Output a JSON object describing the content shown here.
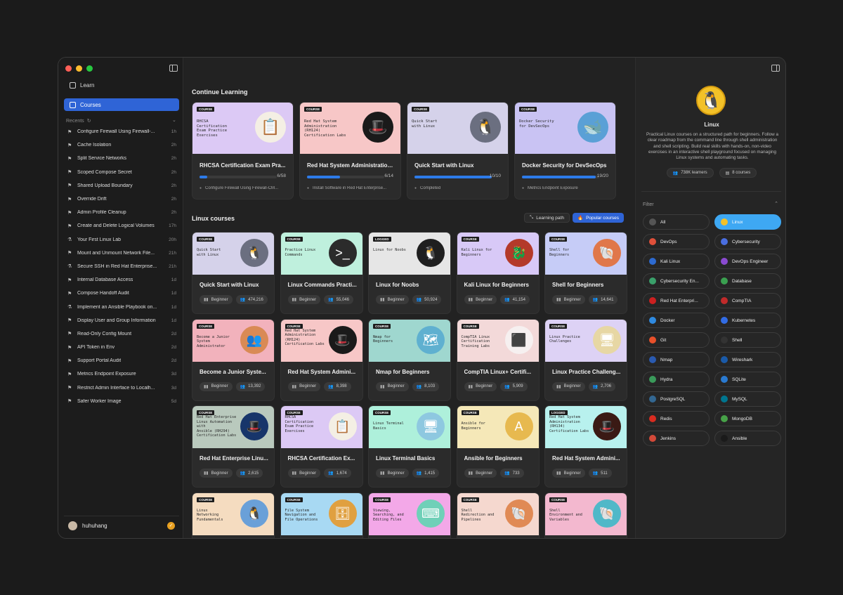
{
  "sidebar": {
    "learn_label": "Learn",
    "courses_label": "Courses",
    "recents_label": "Recents",
    "recents": [
      {
        "icon": "flag",
        "label": "Configure Firewall Using Firewall-...",
        "time": "1h"
      },
      {
        "icon": "flag",
        "label": "Cache Isolation",
        "time": "2h"
      },
      {
        "icon": "flag",
        "label": "Split Service Networks",
        "time": "2h"
      },
      {
        "icon": "flag",
        "label": "Scoped Compose Secret",
        "time": "2h"
      },
      {
        "icon": "flag",
        "label": "Shared Upload Boundary",
        "time": "2h"
      },
      {
        "icon": "flag",
        "label": "Override Drift",
        "time": "2h"
      },
      {
        "icon": "flag",
        "label": "Admin Profile Cleanup",
        "time": "2h"
      },
      {
        "icon": "flag",
        "label": "Create and Delete Logical Volumes",
        "time": "17h"
      },
      {
        "icon": "flask",
        "label": "Your First Linux Lab",
        "time": "20h"
      },
      {
        "icon": "flag",
        "label": "Mount and Unmount Network File...",
        "time": "21h"
      },
      {
        "icon": "flask",
        "label": "Secure SSH in Red Hat Enterprise...",
        "time": "21h"
      },
      {
        "icon": "flag",
        "label": "Internal Database Access",
        "time": "1d"
      },
      {
        "icon": "flag",
        "label": "Compose Handoff Audit",
        "time": "1d"
      },
      {
        "icon": "flask",
        "label": "Implement an Ansible Playbook on...",
        "time": "1d"
      },
      {
        "icon": "flag",
        "label": "Display User and Group Information",
        "time": "1d"
      },
      {
        "icon": "flag",
        "label": "Read-Only Config Mount",
        "time": "2d"
      },
      {
        "icon": "flag",
        "label": "API Token in Env",
        "time": "2d"
      },
      {
        "icon": "flag",
        "label": "Support Portal Audit",
        "time": "2d"
      },
      {
        "icon": "flag",
        "label": "Metrics Endpoint Exposure",
        "time": "3d"
      },
      {
        "icon": "flag",
        "label": "Restrict Admin Interface to Localh...",
        "time": "3d"
      },
      {
        "icon": "flag",
        "label": "Safer Worker Image",
        "time": "5d"
      }
    ],
    "username": "huhuhang"
  },
  "main": {
    "continue_title": "Continue Learning",
    "continue": [
      {
        "tag": "COURSE",
        "thumb": "RHCSA\nCertification\nExam Practice\nExercises",
        "title": "RHCSA Certification Exam Pra...",
        "progress": "6/58",
        "pct": 0.1,
        "sub": "Configure Firewall Using Firewall-CM...",
        "bg": "#dcc9f5",
        "art": "clipboard",
        "artbg": "#f4efe4"
      },
      {
        "tag": "COURSE",
        "thumb": "Red Hat System\nAdministration\n(RH124)\nCertification Labs",
        "title": "Red Hat System Administration...",
        "progress": "6/14",
        "pct": 0.43,
        "sub": "Install Software in Red Hat Enterprise...",
        "bg": "#f7c7c7",
        "art": "redhat",
        "artbg": "#1a1a1a"
      },
      {
        "tag": "COURSE",
        "thumb": "Quick Start\nwith Linux",
        "title": "Quick Start with Linux",
        "progress": "10/10",
        "pct": 1.0,
        "sub": "Completed",
        "bg": "#d5d2ea",
        "art": "penguin",
        "artbg": "#6b6f80"
      },
      {
        "tag": "COURSE",
        "thumb": "Docker Security\nfor DevSecOps",
        "title": "Docker Security for DevSecOps",
        "progress": "19/20",
        "pct": 0.95,
        "sub": "Metrics Endpoint Exposure",
        "bg": "#c9c3f3",
        "art": "whale",
        "artbg": "#5aa0d6"
      }
    ],
    "courses_title": "Linux courses",
    "learning_path_label": "Learning path",
    "popular_label": "Popular courses",
    "courses": [
      {
        "tag": "COURSE",
        "thumb": "Quick Start\nwith Linux",
        "title": "Quick Start with Linux",
        "level": "Beginner",
        "learners": "474,216",
        "bg": "#d5d2ea",
        "artbg": "#6b6f80"
      },
      {
        "tag": "COURSE",
        "thumb": "Practice Linux\nCommands",
        "title": "Linux Commands Practi...",
        "level": "Beginner",
        "learners": "55,046",
        "bg": "#bff0dd",
        "artbg": "#2b2b2b"
      },
      {
        "tag": "LOGGED",
        "thumb": "Linux for Noobs",
        "title": "Linux for Noobs",
        "level": "Beginner",
        "learners": "50,924",
        "bg": "#e6e6e6",
        "artbg": "#1f1f1f"
      },
      {
        "tag": "COURSE",
        "thumb": "Kali Linux for\nBeginners",
        "title": "Kali Linux for Beginners",
        "level": "Beginner",
        "learners": "41,154",
        "bg": "#d8c9f7",
        "artbg": "#b43a2a"
      },
      {
        "tag": "COURSE",
        "thumb": "Shell for\nBeginners",
        "title": "Shell for Beginners",
        "level": "Beginner",
        "learners": "14,641",
        "bg": "#c6ccf7",
        "artbg": "#e0774a"
      },
      {
        "tag": "COURSE",
        "thumb": "Become a Junior\nSystem\nAdministrator",
        "title": "Become a Junior Syste...",
        "level": "Beginner",
        "learners": "13,392",
        "bg": "#f2b2bc",
        "artbg": "#d98a55"
      },
      {
        "tag": "COURSE",
        "thumb": "Red Hat System\nAdministration\n(RH124)\nCertification Labs",
        "title": "Red Hat System Admini...",
        "level": "Beginner",
        "learners": "8,398",
        "bg": "#f7c7c7",
        "artbg": "#1a1a1a"
      },
      {
        "tag": "COURSE",
        "thumb": "Nmap for\nBeginners",
        "title": "Nmap for Beginners",
        "level": "Beginner",
        "learners": "8,103",
        "bg": "#9fd7cf",
        "artbg": "#5fb0d0"
      },
      {
        "tag": "COURSE",
        "thumb": "CompTIA Linux\nCertification\nTraining Labs",
        "title": "CompTIA Linux+ Certifi...",
        "level": "Beginner",
        "learners": "5,909",
        "bg": "#f3d9d9",
        "artbg": "#f6f0f0"
      },
      {
        "tag": "COURSE",
        "thumb": "Linux Practice\nChallenges",
        "title": "Linux Practice Challeng...",
        "level": "Beginner",
        "learners": "2,706",
        "bg": "#ddd2f5",
        "artbg": "#e7d7a4"
      },
      {
        "tag": "COURSE",
        "thumb": "Red Hat Enterprise\nLinux Automation with\nAnsible (RH294)\nCertification Labs",
        "title": "Red Hat Enterprise Linu...",
        "level": "Beginner",
        "learners": "2,615",
        "bg": "#b9c9bd",
        "artbg": "#17356a"
      },
      {
        "tag": "COURSE",
        "thumb": "RHCSA\nCertification\nExam Practice\nExercises",
        "title": "RHCSA Certification Ex...",
        "level": "Beginner",
        "learners": "1,674",
        "bg": "#dcc9f5",
        "artbg": "#f4efe4"
      },
      {
        "tag": "COURSE",
        "thumb": "Linux Terminal\nBasics",
        "title": "Linux Terminal Basics",
        "level": "Beginner",
        "learners": "1,415",
        "bg": "#aef0db",
        "artbg": "#8ec8e0"
      },
      {
        "tag": "COURSE",
        "thumb": "Ansible for\nBeginners",
        "title": "Ansible for Beginners",
        "level": "Beginner",
        "learners": "733",
        "bg": "#f5e8b8",
        "artbg": "#e7b94f"
      },
      {
        "tag": "LOGGED",
        "thumb": "Red Hat System\nAdministration\n(RH134)\nCertification Labs",
        "title": "Red Hat System Admini...",
        "level": "Beginner",
        "learners": "511",
        "bg": "#b8f1ee",
        "artbg": "#3a1a14"
      },
      {
        "tag": "COURSE",
        "thumb": "Linux\nNetworking\nFundamentals",
        "title": "",
        "level": "",
        "learners": "",
        "bg": "#f5dcc0",
        "artbg": "#6aa0d8"
      },
      {
        "tag": "COURSE",
        "thumb": "File System\nNavigation and\nFile Operations",
        "title": "",
        "level": "",
        "learners": "",
        "bg": "#a8d9f3",
        "artbg": "#e0a040"
      },
      {
        "tag": "COURSE",
        "thumb": "Viewing,\nSearching, and\nEditing Files",
        "title": "",
        "level": "",
        "learners": "",
        "bg": "#f3a8e8",
        "artbg": "#6fd0b8"
      },
      {
        "tag": "COURSE",
        "thumb": "Shell\nRedirection and\nPipelines",
        "title": "",
        "level": "",
        "learners": "",
        "bg": "#f5d8cf",
        "artbg": "#e08a55"
      },
      {
        "tag": "COURSE",
        "thumb": "Shell\nEnvironment and\nVariables",
        "title": "",
        "level": "",
        "learners": "",
        "bg": "#f3b8cf",
        "artbg": "#50b8c8"
      }
    ]
  },
  "panel": {
    "title": "Linux",
    "description": "Practical Linux courses on a structured path for beginners. Follow a clear roadmap from the command line through shell administration and shell scripting. Build real skills with hands-on, non-video exercises in an interactive shell playground focused on managing Linux systems and automating tasks.",
    "learners": "738K learners",
    "courses": "8 courses",
    "filter_label": "Filter",
    "filters": [
      {
        "label": "All",
        "color": "#555",
        "selected": false
      },
      {
        "label": "Linux",
        "color": "#f3c128",
        "selected": true
      },
      {
        "label": "DevOps",
        "color": "#e0503a",
        "selected": false
      },
      {
        "label": "Cybersecurity",
        "color": "#4a6ee0",
        "selected": false
      },
      {
        "label": "Kali Linux",
        "color": "#2d6ad0",
        "selected": false
      },
      {
        "label": "DevOps Engineer",
        "color": "#8a4ad0",
        "selected": false
      },
      {
        "label": "Cybersecurity En...",
        "color": "#3aa06a",
        "selected": false
      },
      {
        "label": "Database",
        "color": "#3aa050",
        "selected": false
      },
      {
        "label": "Red Hat Enterpri...",
        "color": "#cc2020",
        "selected": false
      },
      {
        "label": "CompTIA",
        "color": "#c02a2a",
        "selected": false
      },
      {
        "label": "Docker",
        "color": "#2f8ae0",
        "selected": false
      },
      {
        "label": "Kubernetes",
        "color": "#326ce5",
        "selected": false
      },
      {
        "label": "Git",
        "color": "#e8502a",
        "selected": false
      },
      {
        "label": "Shell",
        "color": "#333",
        "selected": false
      },
      {
        "label": "Nmap",
        "color": "#2a5ab0",
        "selected": false
      },
      {
        "label": "Wireshark",
        "color": "#1a5aa8",
        "selected": false
      },
      {
        "label": "Hydra",
        "color": "#3a9a5a",
        "selected": false
      },
      {
        "label": "SQLite",
        "color": "#2a7ad0",
        "selected": false
      },
      {
        "label": "PostgreSQL",
        "color": "#336791",
        "selected": false
      },
      {
        "label": "MySQL",
        "color": "#00758f",
        "selected": false
      },
      {
        "label": "Redis",
        "color": "#d82c20",
        "selected": false
      },
      {
        "label": "MongoDB",
        "color": "#47a248",
        "selected": false
      },
      {
        "label": "Jenkins",
        "color": "#d24939",
        "selected": false
      },
      {
        "label": "Ansible",
        "color": "#1a1a1a",
        "selected": false
      }
    ]
  },
  "colors": {
    "accent": "#2f64d6",
    "filter_selected": "#3ea8f3",
    "progress": "#2d7be9"
  }
}
